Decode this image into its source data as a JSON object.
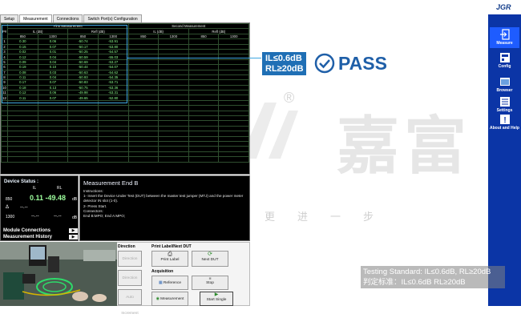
{
  "tabs": [
    "Setup",
    "Measurement",
    "Connections",
    "Switch Port(s) Configuration"
  ],
  "table": {
    "port_header": "P#",
    "first_group": "First Measurement",
    "second_group": "Second Measurement",
    "il_header": "IL (dB)",
    "rl_header": "Refl (dB)",
    "wl1": "850",
    "wl2": "1300",
    "rows": [
      [
        "1",
        "0.30",
        "0.06",
        "-50.74",
        "-53.91"
      ],
      [
        "2",
        "0.15",
        "0.07",
        "-50.17",
        "-53.80"
      ],
      [
        "3",
        "0.02",
        "0.01",
        "-50.25",
        "-54.57"
      ],
      [
        "4",
        "0.12",
        "0.04",
        "-50.59",
        "-55.03"
      ],
      [
        "5",
        "0.09",
        "0.04",
        "-50.69",
        "-53.27"
      ],
      [
        "6",
        "0.19",
        "0.10",
        "-50.44",
        "-54.07"
      ],
      [
        "7",
        "0.08",
        "0.03",
        "-50.63",
        "-54.62"
      ],
      [
        "8",
        "0.11",
        "0.04",
        "-50.93",
        "-54.35"
      ],
      [
        "9",
        "0.17",
        "0.07",
        "-50.83",
        "-53.71"
      ],
      [
        "10",
        "0.18",
        "0.13",
        "-50.75",
        "-53.36"
      ],
      [
        "11",
        "0.12",
        "0.06",
        "-49.98",
        "-53.31"
      ],
      [
        "12",
        "0.11",
        "0.07",
        "-49.65",
        "-52.80"
      ]
    ]
  },
  "device_status": {
    "title": "Device Status :",
    "il_label": "IL",
    "rl_label": "RL",
    "row1_wl": "850",
    "row1_value": "0.11 -49.48",
    "row1_unit": "dB",
    "row_delta": "Δ",
    "row_delta_val": "--.--",
    "row2_wl": "1300",
    "row2_il": "--.--",
    "row2_rl": "--.--",
    "row2_unit": "dB",
    "link1": "Module Connections",
    "link2": "Measurement History"
  },
  "instructions": {
    "title": "Measurement End B",
    "line1": "Instructions:",
    "line2": "1- Insert the Device Under Test (DUT) between the master test jumper (MTJ) and the power meter detector IN slot (1-0).",
    "line3": "2- Press Start.",
    "line4": "Connectors:",
    "line5": "End B:MPO; End A:MPO;"
  },
  "controls": {
    "direction_head": "Direction",
    "print_head": "Print Label/Next DUT",
    "acquisition_head": "Acquisition",
    "dir_btn1": "Direction",
    "dir_btn2": "Direction",
    "dir_btn3": "Auto Increment",
    "print_label": "Print Label",
    "next_dut": "Next DUT",
    "reference": "Reference",
    "stop": "Stop",
    "measurement": "Measurement",
    "start_single": "Start Single"
  },
  "sidebar": {
    "logo": "JGR",
    "items": [
      "Measure",
      "Config",
      "Browser",
      "Settings",
      "About and Help"
    ]
  },
  "overlay": {
    "il_line": "IL≤0.6dB",
    "rl_line": "RL≥20dB",
    "pass": "PASS",
    "watermark": "嘉富",
    "watermark_sub": "更进一步",
    "registered": "®",
    "standard_en": "Testing Standard: IL≤0.6dB, RL≥20dB",
    "standard_cn": "判定标准：IL≤0.6dB  RL≥20dB"
  },
  "colors": {
    "sidebar_bg": "#0b35a6",
    "accent_blue": "#1f6fb5",
    "value_green": "#8cff8c",
    "pass_blue": "#1f5fa8"
  }
}
